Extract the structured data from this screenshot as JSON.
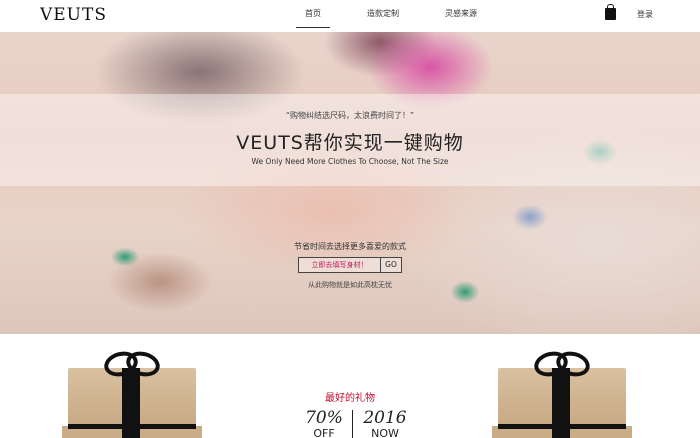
{
  "header": {
    "logo": "VEUTS",
    "nav": [
      {
        "label": "首页",
        "active": true
      },
      {
        "label": "造款定制",
        "active": false
      },
      {
        "label": "灵感来源",
        "active": false
      }
    ],
    "cart_icon": "shopping-bag-icon",
    "login_label": "登录"
  },
  "hero": {
    "quote": "“购物纠结选尺码，太浪费时间了！”",
    "headline": "VEUTS帮你实现一键购物",
    "subline": "We Only Need More Clothes To Choose, Not The Size",
    "cta_text": "节省时间去选择更多喜爱的款式",
    "input_value": "立即去填写身材！",
    "go_label": "GO",
    "note": "从此购物就是如此高枕无忧"
  },
  "gifts": {
    "title": "最好的礼物",
    "percent": "70%",
    "off": "OFF",
    "year": "2016",
    "now": "NOW"
  },
  "colors": {
    "accent_red": "#c8102e",
    "input_text": "#c2185b"
  }
}
